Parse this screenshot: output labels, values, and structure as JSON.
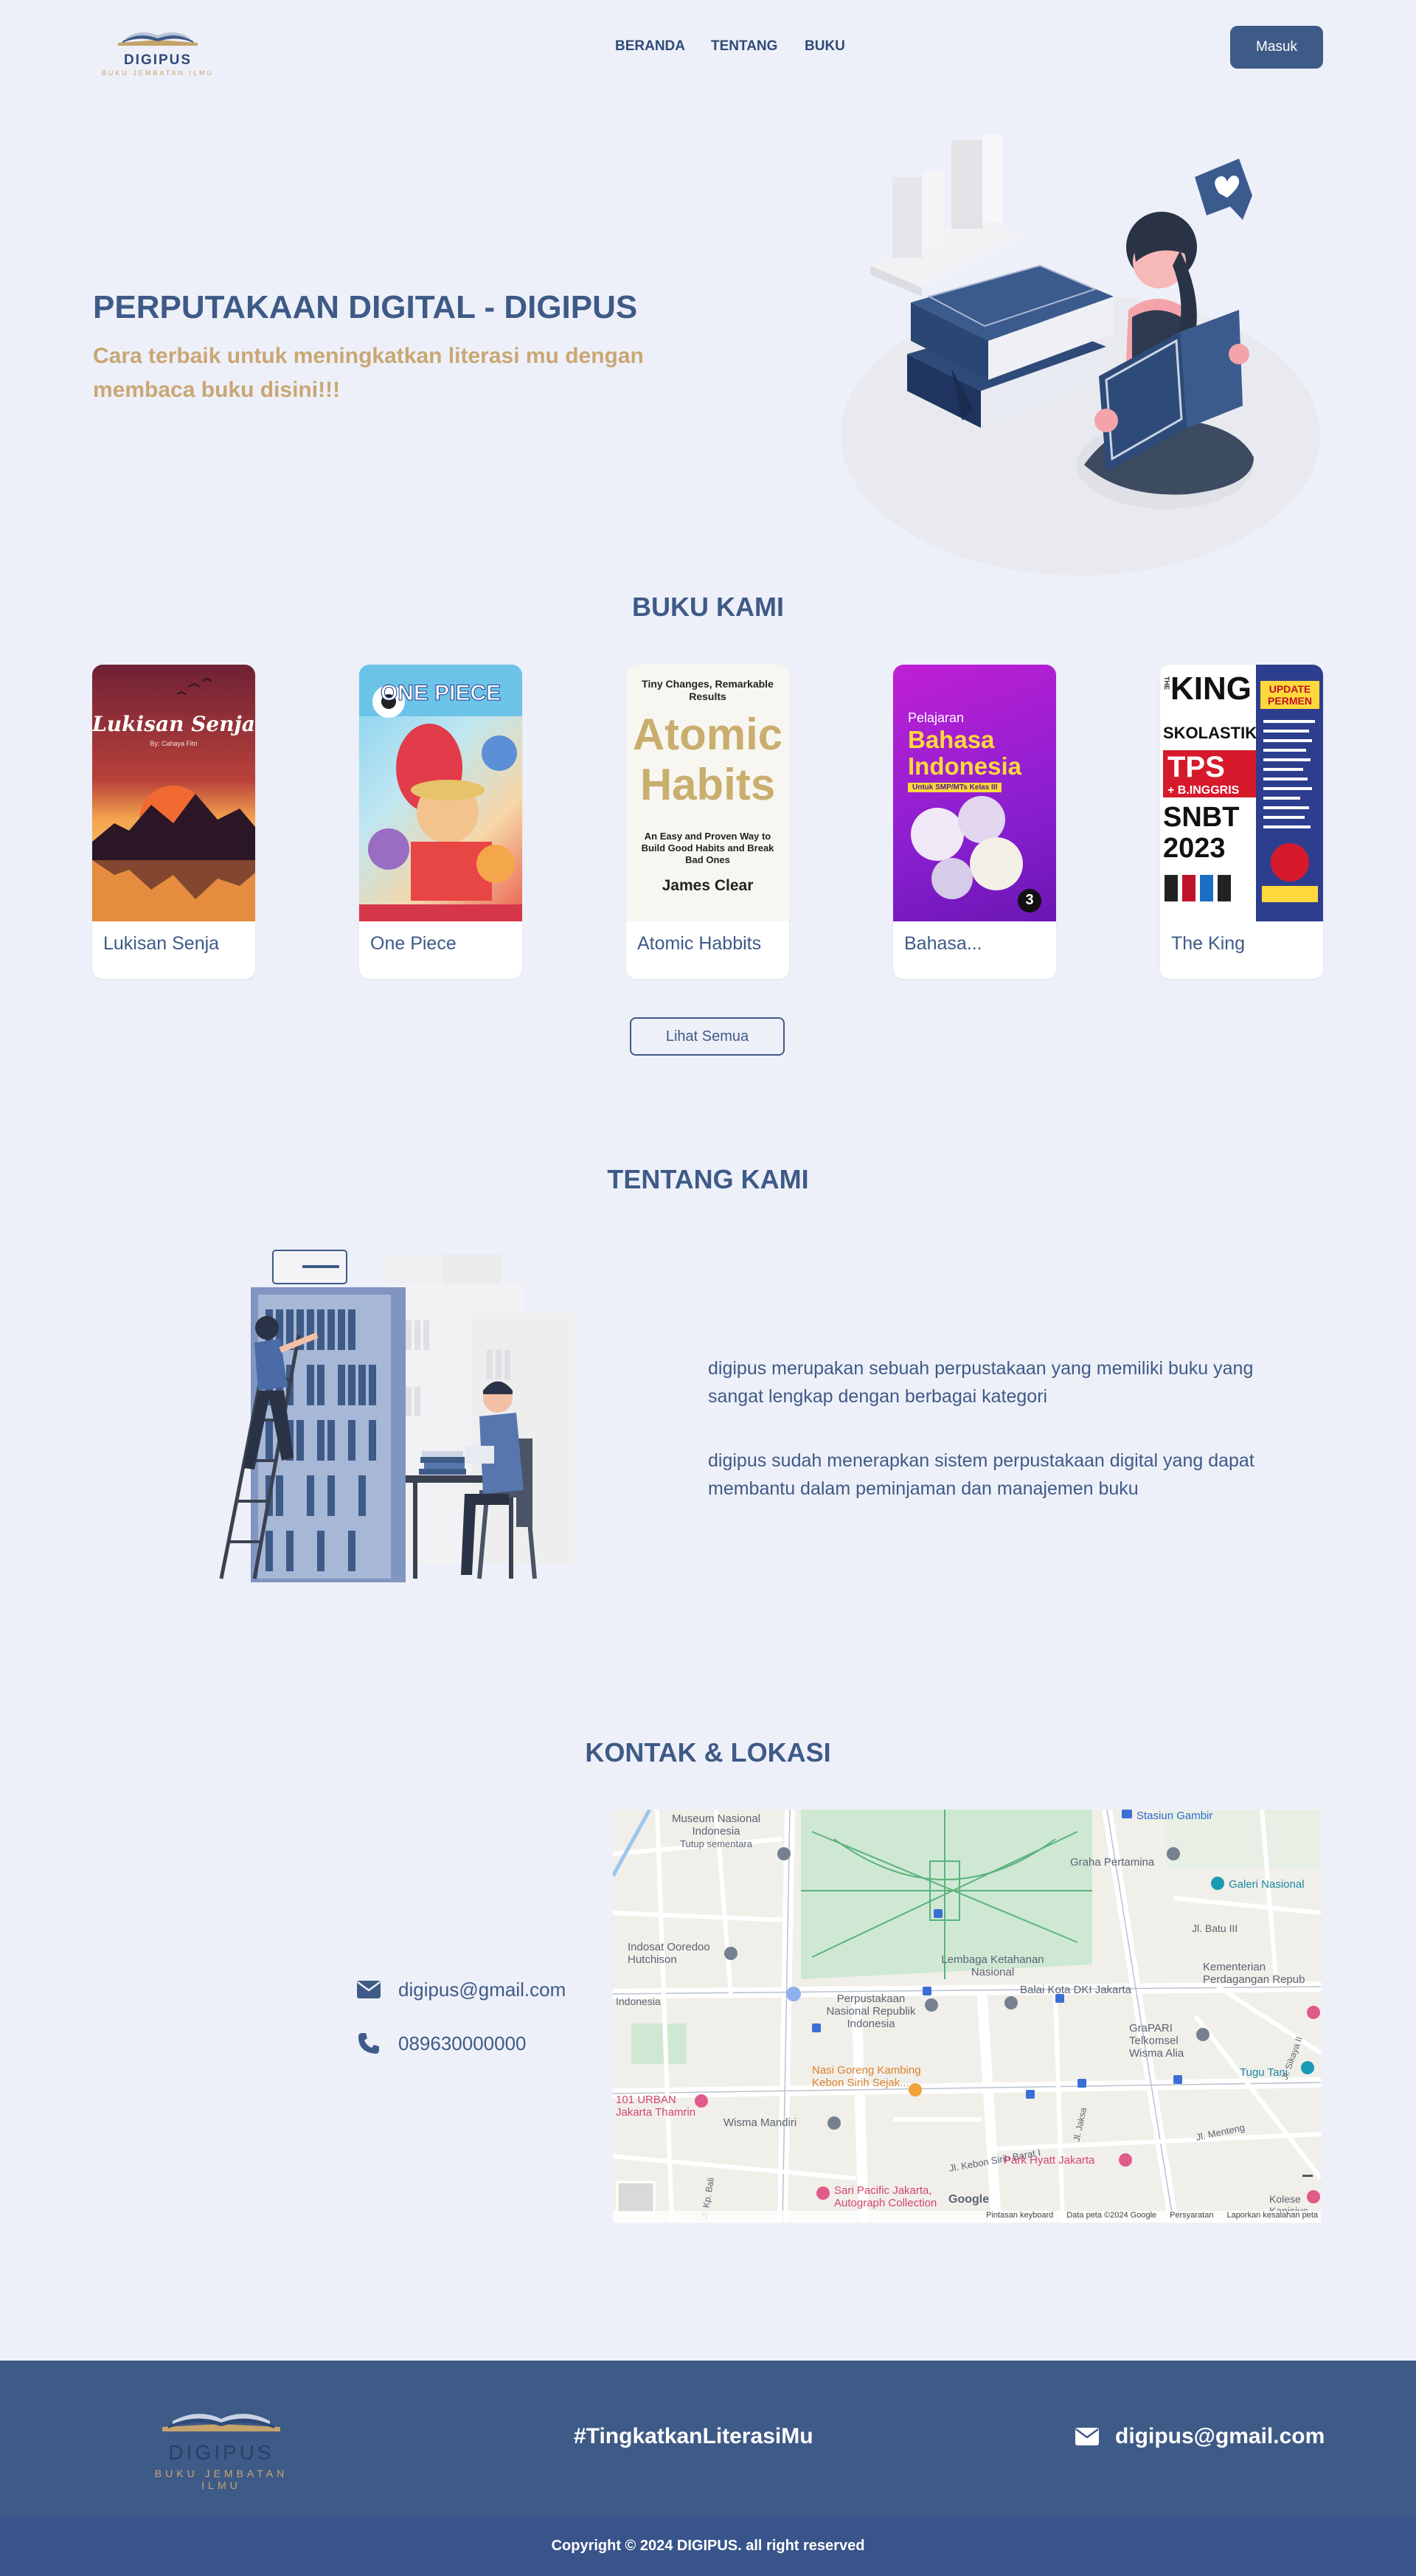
{
  "nav": {
    "logo_text": "DIGIPUS",
    "logo_tagline": "BUKU JEMBATAN ILMU",
    "links": [
      "BERANDA",
      "TENTANG",
      "BUKU"
    ],
    "login_label": "Masuk"
  },
  "hero": {
    "title": "PERPUTAKAAN DIGITAL - DIGIPUS",
    "subtitle": "Cara terbaik untuk meningkatkan literasi mu dengan membaca buku disini!!!"
  },
  "books_section": {
    "title": "BUKU KAMI",
    "books": [
      {
        "title": "Lukisan Senja",
        "cover_text": [
          "Lukisan Senja",
          "By: Cahaya Fitri"
        ]
      },
      {
        "title": "One Piece",
        "cover_text": [
          "ONE PIECE"
        ]
      },
      {
        "title": "Atomic Habbits",
        "cover_text": [
          "Tiny Changes, Remarkable Results",
          "Atomic",
          "Habits",
          "An Easy and Proven Way to Build Good Habits and Break Bad Ones",
          "James Clear"
        ]
      },
      {
        "title": "Bahasa...",
        "cover_text": [
          "Pelajaran",
          "Bahasa Indonesia",
          "Untuk SMP/MTs Kelas III",
          "3"
        ]
      },
      {
        "title": "The King",
        "cover_text": [
          "THE",
          "KING",
          "UPDATE PERMEN",
          "SKOLASTIK",
          "TPS",
          "+ B.INGGRIS",
          "SNBT",
          "2023"
        ]
      }
    ],
    "see_all_label": "Lihat Semua"
  },
  "about": {
    "title": "TENTANG KAMI",
    "paragraphs": [
      "digipus merupakan sebuah perpustakaan yang memiliki buku yang sangat lengkap dengan berbagai kategori",
      "digipus sudah menerapkan sistem perpustakaan digital yang dapat membantu dalam peminjaman dan manajemen buku"
    ]
  },
  "contact": {
    "title": "KONTAK & LOKASI",
    "email": "digipus@gmail.com",
    "phone": "089630000000",
    "map": {
      "labels": [
        "Museum Nasional Indonesia",
        "Tutup sementara",
        "Stasiun Gambir",
        "Graha Pertamina",
        "Galeri Nasional",
        "Jl. Batu III",
        "Indosat Ooredoo Hutchison",
        "Lembaga Ketahanan Nasional",
        "Kementerian Perdagangan Repub",
        "Perpustakaan Nasional Republik Indonesia",
        "Balai Kota DKI Jakarta",
        "GraPARI Telkomsel Wisma Alia",
        "Tugu Tani",
        "Nasi Goreng Kambing Kebon Sirih Sejak...",
        "101 URBAN Jakarta Thamrin",
        "Wisma Mandiri",
        "Jl. Kebon Sirih Barat I",
        "Park Hyatt Jakarta",
        "Jl. Menteng",
        "Sari Pacific Jakarta, Autograph Collection",
        "Kolese Kanisius",
        "Jl. Jaksa",
        "Jl. Kp. Bali",
        "Jl. Sikaya II",
        "Indonesia"
      ],
      "footer": [
        "Pintasan keyboard",
        "Data peta ©2024 Google",
        "Persyaratan",
        "Laporkan kesalahan peta"
      ],
      "google_label": "Google"
    }
  },
  "footer": {
    "logo_text": "DIGIPUS",
    "logo_tagline": "BUKU JEMBATAN ILMU",
    "hashtag": "#TingkatkanLiterasiMu",
    "email": "digipus@gmail.com",
    "copyright": "Copyright © 2024 DIGIPUS. all right reserved"
  },
  "colors": {
    "primary": "#3e5a87",
    "accent": "#c9a774",
    "background": "#eef0f9"
  },
  "icons": [
    "envelope-icon",
    "phone-icon",
    "zoom-out-icon"
  ]
}
